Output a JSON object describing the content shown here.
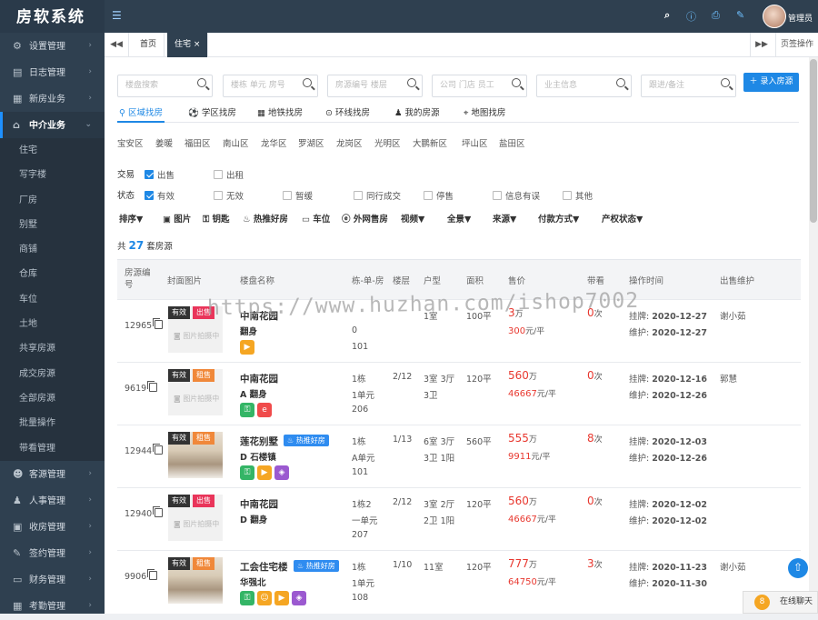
{
  "app": {
    "title": "房软系统"
  },
  "sidebar": {
    "items": [
      {
        "label": "设置管理",
        "icon": "gear-icon",
        "glyph": "⚙"
      },
      {
        "label": "日志管理",
        "icon": "log-icon",
        "glyph": "▤"
      },
      {
        "label": "新房业务",
        "icon": "building-icon",
        "glyph": "▦"
      },
      {
        "label": "中介业务",
        "icon": "home-icon",
        "glyph": "⌂"
      }
    ],
    "sub_items": [
      "住宅",
      "写字楼",
      "厂房",
      "别墅",
      "商铺",
      "仓库",
      "车位",
      "土地",
      "共享房源",
      "成交房源",
      "全部房源",
      "批量操作",
      "带看管理"
    ],
    "bottom_items": [
      {
        "label": "客源管理",
        "icon": "people-icon",
        "glyph": "☻"
      },
      {
        "label": "人事管理",
        "icon": "org-icon",
        "glyph": "♟"
      },
      {
        "label": "收房管理",
        "icon": "inbox-icon",
        "glyph": "▣"
      },
      {
        "label": "签约管理",
        "icon": "contract-icon",
        "glyph": "✎"
      },
      {
        "label": "财务管理",
        "icon": "wallet-icon",
        "glyph": "▭"
      },
      {
        "label": "考勤管理",
        "icon": "calendar-icon",
        "glyph": "▦"
      }
    ]
  },
  "topbar": {
    "user": "管理员"
  },
  "tabbar": {
    "tabs": [
      "首页",
      "住宅"
    ],
    "close": "×",
    "page_ops": "页签操作"
  },
  "filters": {
    "placeholders": [
      "楼盘搜索",
      "楼栋 单元 房号",
      "房源编号 楼层",
      "公司 门店 员工",
      "业主信息",
      "跟进/备注"
    ],
    "add_button": "录入房源",
    "modes": [
      "区域找房",
      "学区找房",
      "地铁找房",
      "环线找房",
      "我的房源",
      "地图找房"
    ],
    "districts": [
      "宝安区",
      "姜暖",
      "福田区",
      "南山区",
      "龙华区",
      "罗湖区",
      "龙岗区",
      "光明区",
      "大鹏新区",
      "坪山区",
      "盐田区"
    ],
    "trade_label": "交易",
    "trade_options": [
      {
        "label": "出售",
        "checked": true
      },
      {
        "label": "出租",
        "checked": false
      }
    ],
    "status_label": "状态",
    "status_options": [
      {
        "label": "有效",
        "checked": true
      },
      {
        "label": "无效",
        "checked": false
      },
      {
        "label": "暂缓",
        "checked": false
      },
      {
        "label": "同行成交",
        "checked": false
      },
      {
        "label": "停售",
        "checked": false
      },
      {
        "label": "信息有误",
        "checked": false
      },
      {
        "label": "其他",
        "checked": false
      }
    ],
    "sort_items": [
      "排序▼",
      "图片",
      "钥匙",
      "热推好房",
      "车位",
      "外网售房",
      "视频▼",
      "全景▼",
      "来源▼",
      "付款方式▼",
      "产权状态▼"
    ]
  },
  "summary": {
    "prefix": "共",
    "count": "27",
    "suffix": "套房源"
  },
  "table": {
    "columns": [
      "房源编号",
      "封面图片",
      "楼盘名称",
      "栋-单-房",
      "楼层",
      "户型",
      "面积",
      "售价",
      "带看",
      "操作时间",
      "出售维护"
    ],
    "photo_placeholder": "图片拍摄中",
    "listed_label": "挂牌:",
    "maint_label": "维护:",
    "rows": [
      {
        "id": "12965",
        "badges": [
          "有效",
          "出售"
        ],
        "estate": "中南花园",
        "sub": "翻身",
        "hot": "",
        "icons": [
          "video"
        ],
        "building": "",
        "unit": "0",
        "room": "101",
        "floor": "",
        "layout1": "1室",
        "layout2": "",
        "area": "100平",
        "price": "3",
        "price_unit": "万",
        "unit_price": "300",
        "unit_price_suffix": "元/平",
        "visits": "0",
        "visits_suffix": "次",
        "listed": "2020-12-27",
        "maintained": "2020-12-27",
        "agent": "谢小茹",
        "has_image": false
      },
      {
        "id": "9619",
        "badges": [
          "有效",
          "租售"
        ],
        "estate": "中南花园",
        "sub": "A 翻身",
        "hot": "",
        "icons": [
          "key",
          "web"
        ],
        "building": "1栋",
        "unit": "1单元",
        "room": "206",
        "floor": "2/12",
        "layout1": "3室 3厅",
        "layout2": "3卫",
        "area": "120平",
        "price": "560",
        "price_unit": "万",
        "unit_price": "46667",
        "unit_price_suffix": "元/平",
        "visits": "0",
        "visits_suffix": "次",
        "listed": "2020-12-16",
        "maintained": "2020-12-26",
        "agent": "郭慧",
        "has_image": false
      },
      {
        "id": "12944",
        "badges": [
          "有效",
          "租售"
        ],
        "estate": "莲花别墅",
        "sub": "D 石楼镇",
        "hot": "热推好房",
        "icons": [
          "key",
          "video",
          "vr"
        ],
        "building": "1栋",
        "unit": "A单元",
        "room": "101",
        "floor": "1/13",
        "layout1": "6室 3厅",
        "layout2": "3卫 1阳",
        "area": "560平",
        "price": "555",
        "price_unit": "万",
        "unit_price": "9911",
        "unit_price_suffix": "元/平",
        "visits": "8",
        "visits_suffix": "次",
        "listed": "2020-12-03",
        "maintained": "2020-12-26",
        "agent": "",
        "has_image": true
      },
      {
        "id": "12940",
        "badges": [
          "有效",
          "出售"
        ],
        "estate": "中南花园",
        "sub": "D 翻身",
        "hot": "",
        "icons": [],
        "building": "1栋2",
        "unit": "一单元",
        "room": "207",
        "floor": "2/12",
        "layout1": "3室 2厅",
        "layout2": "2卫 1阳",
        "area": "120平",
        "price": "560",
        "price_unit": "万",
        "unit_price": "46667",
        "unit_price_suffix": "元/平",
        "visits": "0",
        "visits_suffix": "次",
        "listed": "2020-12-02",
        "maintained": "2020-12-02",
        "agent": "",
        "has_image": false
      },
      {
        "id": "9906",
        "badges": [
          "有效",
          "租售"
        ],
        "estate": "工会住宅楼",
        "sub": "华强北",
        "hot": "热推好房",
        "icons": [
          "key",
          "person",
          "video",
          "vr"
        ],
        "building": "1栋",
        "unit": "1单元",
        "room": "108",
        "floor": "1/10",
        "layout1": "11室",
        "layout2": "",
        "area": "120平",
        "price": "777",
        "price_unit": "万",
        "unit_price": "64750",
        "unit_price_suffix": "元/平",
        "visits": "3",
        "visits_suffix": "次",
        "listed": "2020-11-23",
        "maintained": "2020-11-30",
        "agent": "谢小茹",
        "has_image": true
      }
    ]
  },
  "watermark": "https://www.huzhan.com/ishop7002",
  "chat": {
    "label": "在线聊天"
  }
}
